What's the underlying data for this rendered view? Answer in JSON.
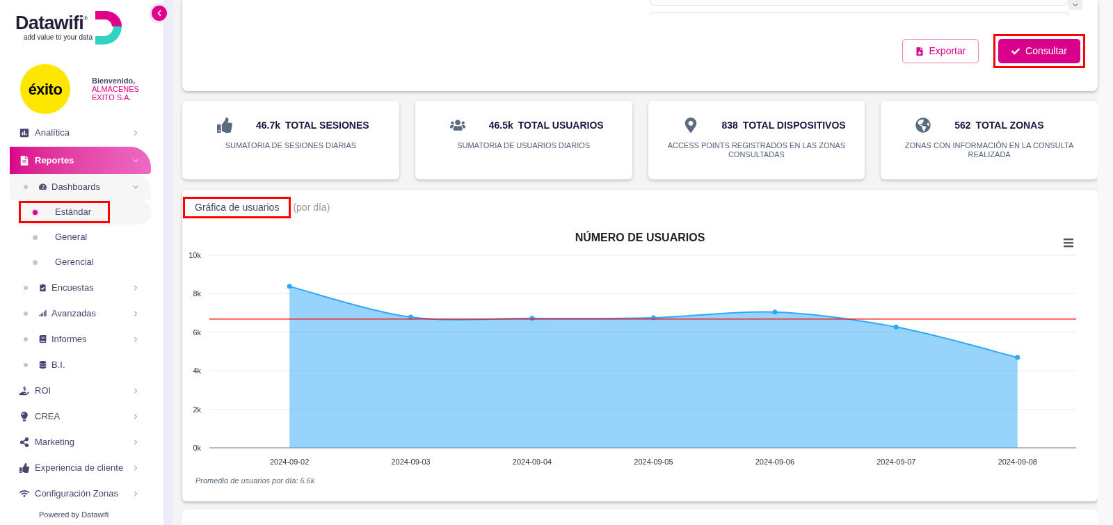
{
  "sidebar": {
    "logo": {
      "name": "Datawifi",
      "mark": "®",
      "tagline": "add value to your data"
    },
    "client": {
      "logo_text": "éxito",
      "greeting": "Bienvenido,",
      "name": "ALMACENES EXITO S.A."
    },
    "items": [
      {
        "label": "Analítica",
        "selected": false,
        "expanded": false
      },
      {
        "label": "Reportes",
        "selected": true,
        "expanded": true,
        "children": [
          {
            "label": "Dashboards",
            "selected": false,
            "expanded": true,
            "children": [
              {
                "label": "Estándar",
                "selected": true,
                "highlighted": true
              },
              {
                "label": "General",
                "selected": false,
                "highlighted": false
              },
              {
                "label": "Gerencial",
                "selected": false,
                "highlighted": false
              }
            ]
          },
          {
            "label": "Encuestas",
            "selected": false,
            "expanded": false
          },
          {
            "label": "Avanzadas",
            "selected": false,
            "expanded": false
          },
          {
            "label": "Informes",
            "selected": false,
            "expanded": false
          },
          {
            "label": "B.I.",
            "selected": false
          }
        ]
      },
      {
        "label": "ROI",
        "selected": false,
        "expanded": false
      },
      {
        "label": "CREA",
        "selected": false,
        "expanded": false
      },
      {
        "label": "Marketing",
        "selected": false,
        "expanded": false
      },
      {
        "label": "Experiencia de cliente",
        "selected": false,
        "expanded": false
      },
      {
        "label": "Configuración Zonas",
        "selected": false,
        "expanded": false
      }
    ],
    "footer": "Powered by Datawifi"
  },
  "actions": [
    {
      "label": "Exportar",
      "kind": "outline",
      "highlighted": false
    },
    {
      "label": "Consultar",
      "kind": "primary",
      "highlighted": true
    }
  ],
  "stats": [
    {
      "value": "46.7k",
      "label": "TOTAL SESIONES",
      "description": "SUMATORIA DE SESIONES DIARIAS"
    },
    {
      "value": "46.5k",
      "label": "TOTAL USUARIOS",
      "description": "SUMATORIA DE USUARIOS DIARIOS"
    },
    {
      "value": "838",
      "label": "TOTAL DISPOSITIVOS",
      "description": "ACCESS POINTS REGISTRADOS EN LAS ZONAS CONSULTADAS"
    },
    {
      "value": "562",
      "label": "TOTAL ZONAS",
      "description": "ZONAS CON INFORMACIÓN EN LA CONSULTA REALIZADA"
    }
  ],
  "chart_card": {
    "title": "Gráfica de usuarios",
    "title_highlighted": true,
    "subtitle": "(por día)",
    "note": "Promedio de usuarios por día: 6.6k",
    "chart_data": {
      "type": "area",
      "title": "NÚMERO DE USUARIOS",
      "categories": [
        "2024-09-02",
        "2024-09-03",
        "2024-09-04",
        "2024-09-05",
        "2024-09-06",
        "2024-09-07",
        "2024-09-08"
      ],
      "series": [
        {
          "color": "#2fa8f5",
          "values": [
            8380,
            6790,
            6720,
            6750,
            7050,
            6270,
            4690
          ]
        }
      ],
      "ylim": [
        0,
        10000
      ],
      "yticks": [
        {
          "value": 0,
          "label": "0k"
        },
        {
          "value": 2000,
          "label": "2k"
        },
        {
          "value": 4000,
          "label": "4k"
        },
        {
          "value": 6000,
          "label": "6k"
        },
        {
          "value": 8000,
          "label": "8k"
        },
        {
          "value": 10000,
          "label": "10k"
        }
      ],
      "grid": true,
      "ref_lines": [
        {
          "value": 6680,
          "axis": "y",
          "color": "#ff0000"
        }
      ]
    }
  }
}
